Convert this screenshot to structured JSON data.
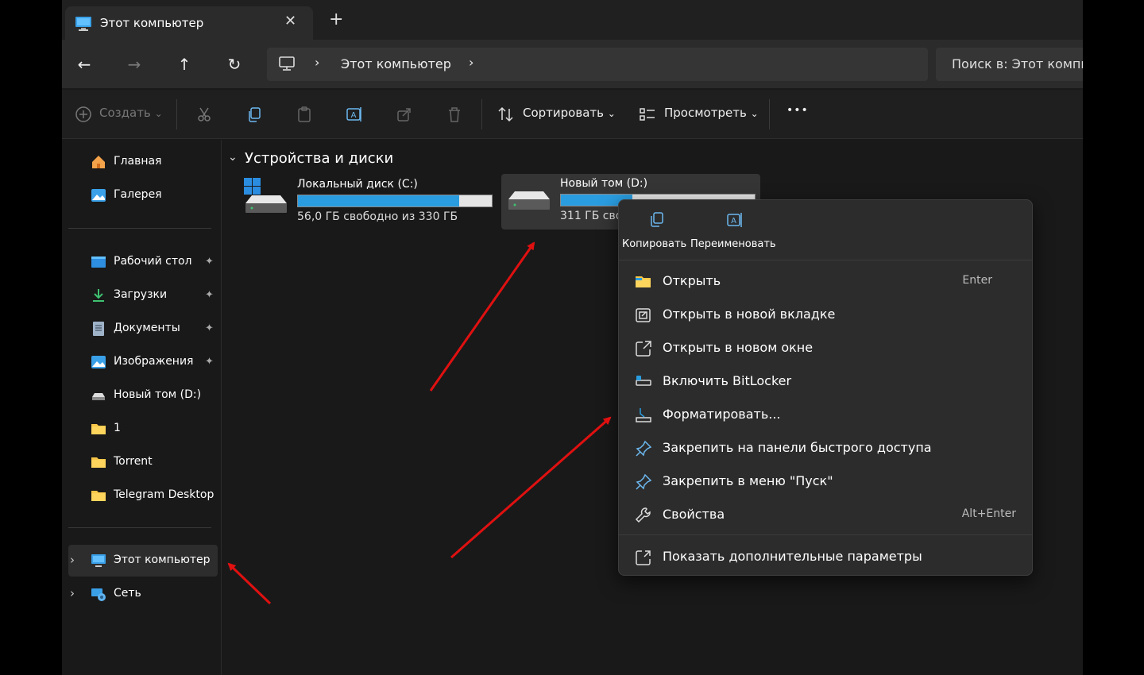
{
  "window": {
    "tab_title": "Этот компьютер",
    "tab_close": "✕",
    "new_tab": "+"
  },
  "nav": {
    "back": "←",
    "forward": "→",
    "up": "↑",
    "refresh": "↻",
    "breadcrumb_sep": "›",
    "breadcrumb": [
      "Этот компьютер"
    ],
    "search_placeholder": "Поиск в: Этот компьютер"
  },
  "toolbar": {
    "create": "Создать",
    "sort": "Сортировать",
    "view": "Просмотреть",
    "more": "•••",
    "chevron": "⌄"
  },
  "sidebar": {
    "top": [
      {
        "label": "Главная",
        "icon": "home-icon"
      },
      {
        "label": "Галерея",
        "icon": "gallery-icon"
      }
    ],
    "quick_access": [
      {
        "label": "Рабочий стол",
        "icon": "desktop-icon",
        "pinned": true
      },
      {
        "label": "Загрузки",
        "icon": "download-icon",
        "pinned": true
      },
      {
        "label": "Документы",
        "icon": "documents-icon",
        "pinned": true
      },
      {
        "label": "Изображения",
        "icon": "pictures-icon",
        "pinned": true
      },
      {
        "label": "Новый том (D:)",
        "icon": "drive-icon",
        "pinned": false
      },
      {
        "label": "1",
        "icon": "folder-icon",
        "pinned": false
      },
      {
        "label": "Torrent",
        "icon": "folder-icon",
        "pinned": false
      },
      {
        "label": "Telegram Desktop",
        "icon": "folder-icon",
        "pinned": false
      }
    ],
    "pin_glyph": "📌",
    "expand_glyph": "›",
    "bottom": [
      {
        "label": "Этот компьютер",
        "icon": "computer-icon",
        "selected": true
      },
      {
        "label": "Сеть",
        "icon": "network-icon",
        "selected": false
      }
    ]
  },
  "content": {
    "section_title": "Устройства и диски",
    "section_chevron": "⌄",
    "drives": [
      {
        "name": "Локальный диск (C:)",
        "free_text": "56,0 ГБ свободно из 330 ГБ",
        "used_fraction": 0.83
      },
      {
        "name": "Новый том (D:)",
        "free_text": "311 ГБ сво",
        "used_fraction": 0.37
      }
    ]
  },
  "context_menu": {
    "top_actions": [
      {
        "label": "Копировать",
        "icon": "copy-icon"
      },
      {
        "label": "Переименовать",
        "icon": "rename-icon"
      }
    ],
    "items": [
      {
        "label": "Открыть",
        "shortcut": "Enter",
        "icon": "folder-open-icon"
      },
      {
        "label": "Открыть в новой вкладке",
        "shortcut": "",
        "icon": "new-tab-icon"
      },
      {
        "label": "Открыть в новом окне",
        "shortcut": "",
        "icon": "new-window-icon"
      },
      {
        "label": "Включить BitLocker",
        "shortcut": "",
        "icon": "bitlocker-icon"
      },
      {
        "label": "Форматировать...",
        "shortcut": "",
        "icon": "format-icon"
      },
      {
        "label": "Закрепить на панели быстрого доступа",
        "shortcut": "",
        "icon": "pin-icon"
      },
      {
        "label": "Закрепить в меню \"Пуск\"",
        "shortcut": "",
        "icon": "pin-start-icon"
      },
      {
        "label": "Свойства",
        "shortcut": "Alt+Enter",
        "icon": "properties-icon"
      }
    ],
    "more_options": {
      "label": "Показать дополнительные параметры",
      "icon": "more-options-icon"
    }
  },
  "colors": {
    "accent": "#2a9de0",
    "annotation_arrow": "#e01010"
  }
}
